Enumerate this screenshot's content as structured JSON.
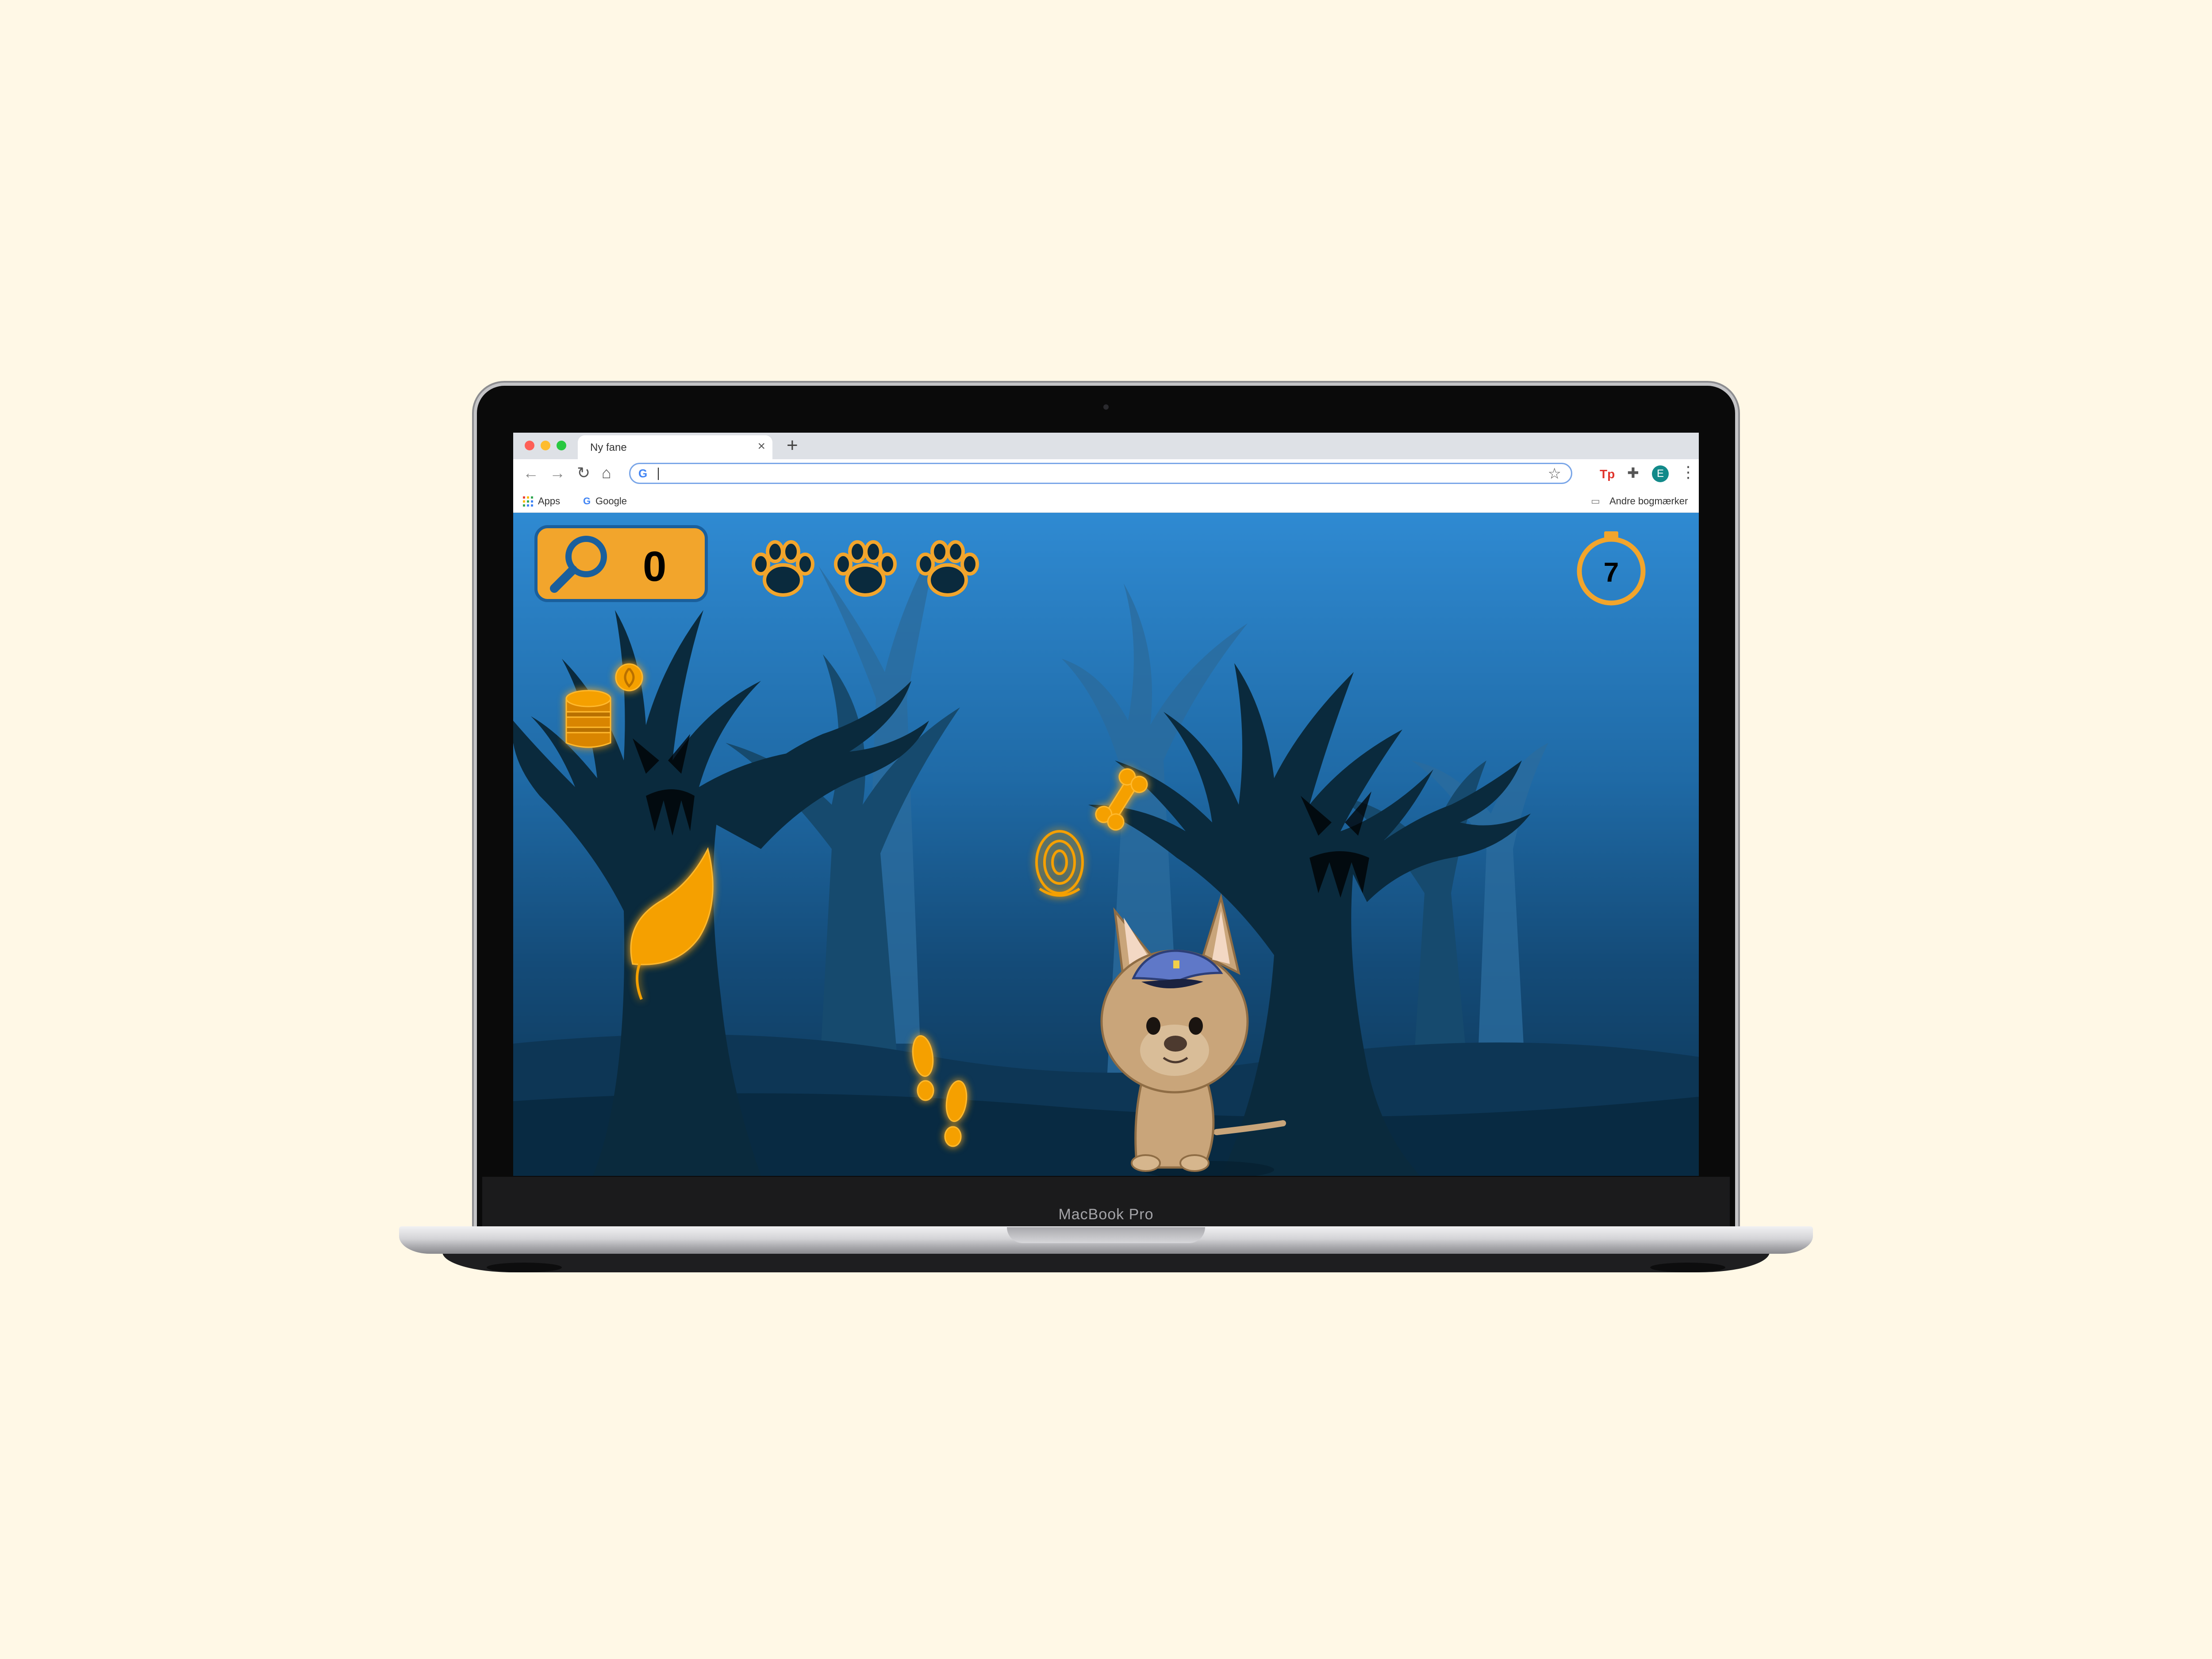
{
  "browser": {
    "tab_title": "Ny fane",
    "tab_close": "×",
    "new_tab": "+",
    "address_value": "",
    "bookmarks": {
      "apps_label": "Apps",
      "google_label": "Google",
      "other_label": "Andre bogmærker"
    },
    "profile_initial": "E",
    "ext_label": "Tp"
  },
  "laptop": {
    "brand": "MacBook Pro"
  },
  "game": {
    "score": "0",
    "lives": 3,
    "timer": "7",
    "accent_color": "#f2a52c",
    "frame_color": "#1a5f9c",
    "items": [
      "dog-food-can-icon",
      "bone-icon",
      "fingerprint-icon",
      "leaf-icon",
      "footprints-icon"
    ],
    "character": "police-dog-icon"
  }
}
